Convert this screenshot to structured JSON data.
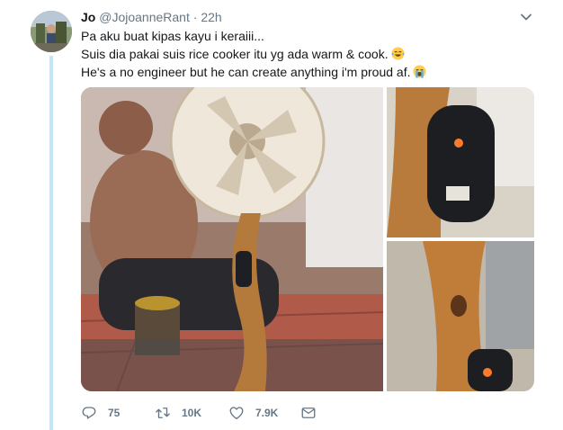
{
  "tweet": {
    "name": "Jo",
    "handle": "@JojoanneRant",
    "separator": "·",
    "time": "22h",
    "lines": [
      "Pa aku buat kipas kayu i keraiii...",
      "Suis dia pakai suis rice cooker itu yg ada warm & cook.",
      "He's a no engineer but he can create anything i'm proud af."
    ],
    "emojis": [
      "face-with-tears-of-joy",
      "loudly-crying-face"
    ]
  },
  "actions": {
    "replies": "75",
    "retweets": "10K",
    "likes": "7.9K"
  },
  "icons": [
    "chevron-down-icon",
    "reply-icon",
    "retweet-icon",
    "heart-icon",
    "message-icon"
  ],
  "colors": {
    "thread_line": "#c4e4f7",
    "meta": "#657786",
    "text": "#14171a"
  }
}
